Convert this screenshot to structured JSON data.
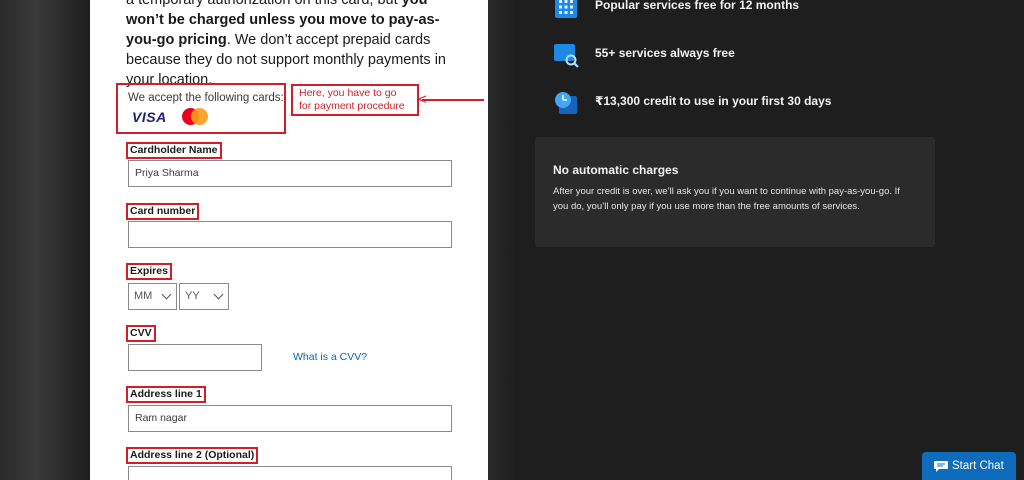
{
  "intro": {
    "line1_prefix": "a temporary authorization on this card, but ",
    "line1_bold": "you won’t be charged unless you move to pay-as-you-go pricing",
    "line1_suffix": ". We don’t accept prepaid cards because they do not support monthly payments in your location."
  },
  "accepted_cards": {
    "label": "We accept the following cards:",
    "visa": "VISA",
    "mastercard_icon": "mastercard-logo"
  },
  "annotation": {
    "text": "Here, you have to go for payment procedure",
    "color": "#d11f2a"
  },
  "form": {
    "cardholder_label": "Cardholder Name",
    "cardholder_value": "Priya Sharma",
    "card_number_label": "Card number",
    "card_number_value": "",
    "expires_label": "Expires",
    "month_value": "MM",
    "year_value": "YY",
    "cvv_label": "CVV",
    "cvv_value": "",
    "cvv_link": "What is a CVV?",
    "address1_label": "Address line 1",
    "address1_value": "Ram nagar",
    "address2_label": "Address line 2 (Optional)",
    "address2_value": ""
  },
  "benefits": [
    {
      "icon": "calendar-grid-icon",
      "text": "Popular services free for 12 months"
    },
    {
      "icon": "monitor-search-icon",
      "text": "55+ services always free"
    },
    {
      "icon": "clock-credit-icon",
      "text": "₹13,300 credit to use in your first 30 days"
    }
  ],
  "no_charges": {
    "title": "No automatic charges",
    "body": "After your credit is over, we’ll ask you if you want to continue with pay-as-you-go. If you do, you’ll only pay if you use more than the free amounts of services."
  },
  "chat": {
    "label": "Start Chat",
    "icon": "chat-bubble-icon",
    "color": "#0f6cbd"
  },
  "colors": {
    "accent": "#0067b8",
    "highlight_border": "#d11f2a",
    "dark_bg": "#1e1e1e"
  }
}
